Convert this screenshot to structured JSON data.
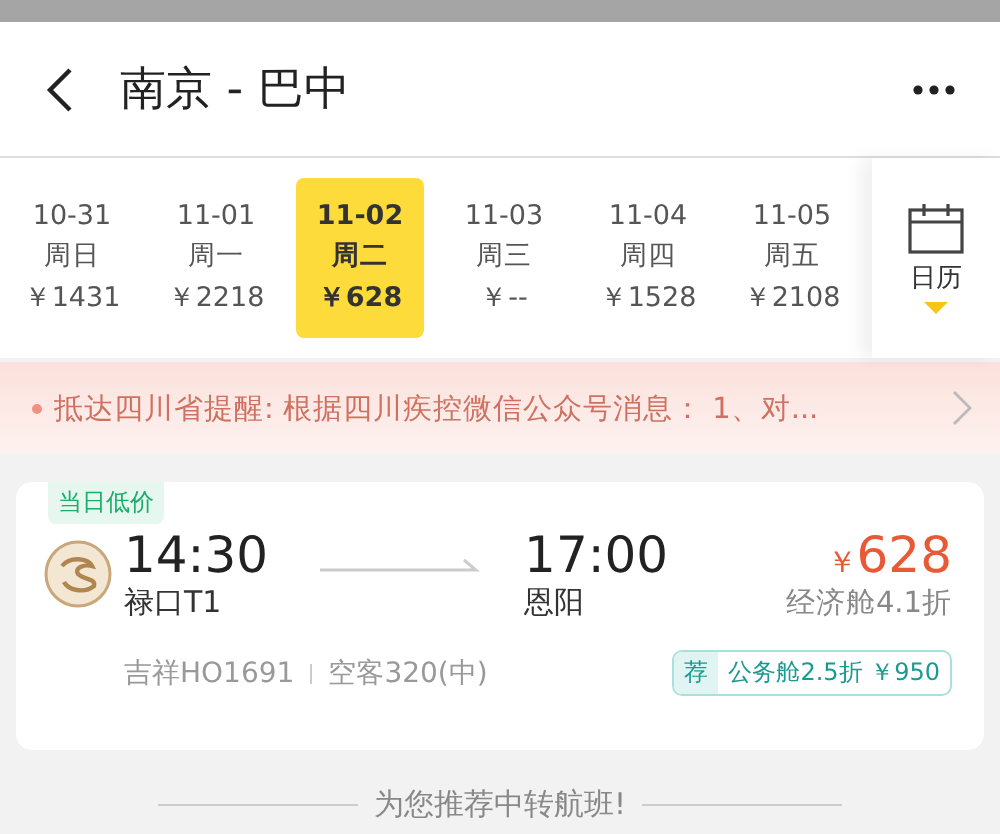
{
  "header": {
    "title": "南京 - 巴中"
  },
  "dates": [
    {
      "date": "10-31",
      "weekday": "周日",
      "price": "￥1431",
      "selected": false
    },
    {
      "date": "11-01",
      "weekday": "周一",
      "price": "￥2218",
      "selected": false
    },
    {
      "date": "11-02",
      "weekday": "周二",
      "price": "￥628",
      "selected": true
    },
    {
      "date": "11-03",
      "weekday": "周三",
      "price": "￥--",
      "selected": false
    },
    {
      "date": "11-04",
      "weekday": "周四",
      "price": "￥1528",
      "selected": false
    },
    {
      "date": "11-05",
      "weekday": "周五",
      "price": "￥2108",
      "selected": false
    }
  ],
  "calendar": {
    "label": "日历"
  },
  "notice": {
    "text": "抵达四川省提醒: 根据四川疾控微信公众号消息： 1、对..."
  },
  "flight": {
    "tag": "当日低价",
    "depart_time": "14:30",
    "depart_airport": "禄口T1",
    "arrive_time": "17:00",
    "arrive_airport": "恩阳",
    "currency": "￥",
    "price": "628",
    "cabin": "经济舱4.1折",
    "airline_flight": "吉祥HO1691",
    "aircraft": "空客320(中)",
    "recommend_badge": "荐",
    "recommend_text": "公务舱2.5折 ￥950"
  },
  "transfer_heading": "为您推荐中转航班!"
}
